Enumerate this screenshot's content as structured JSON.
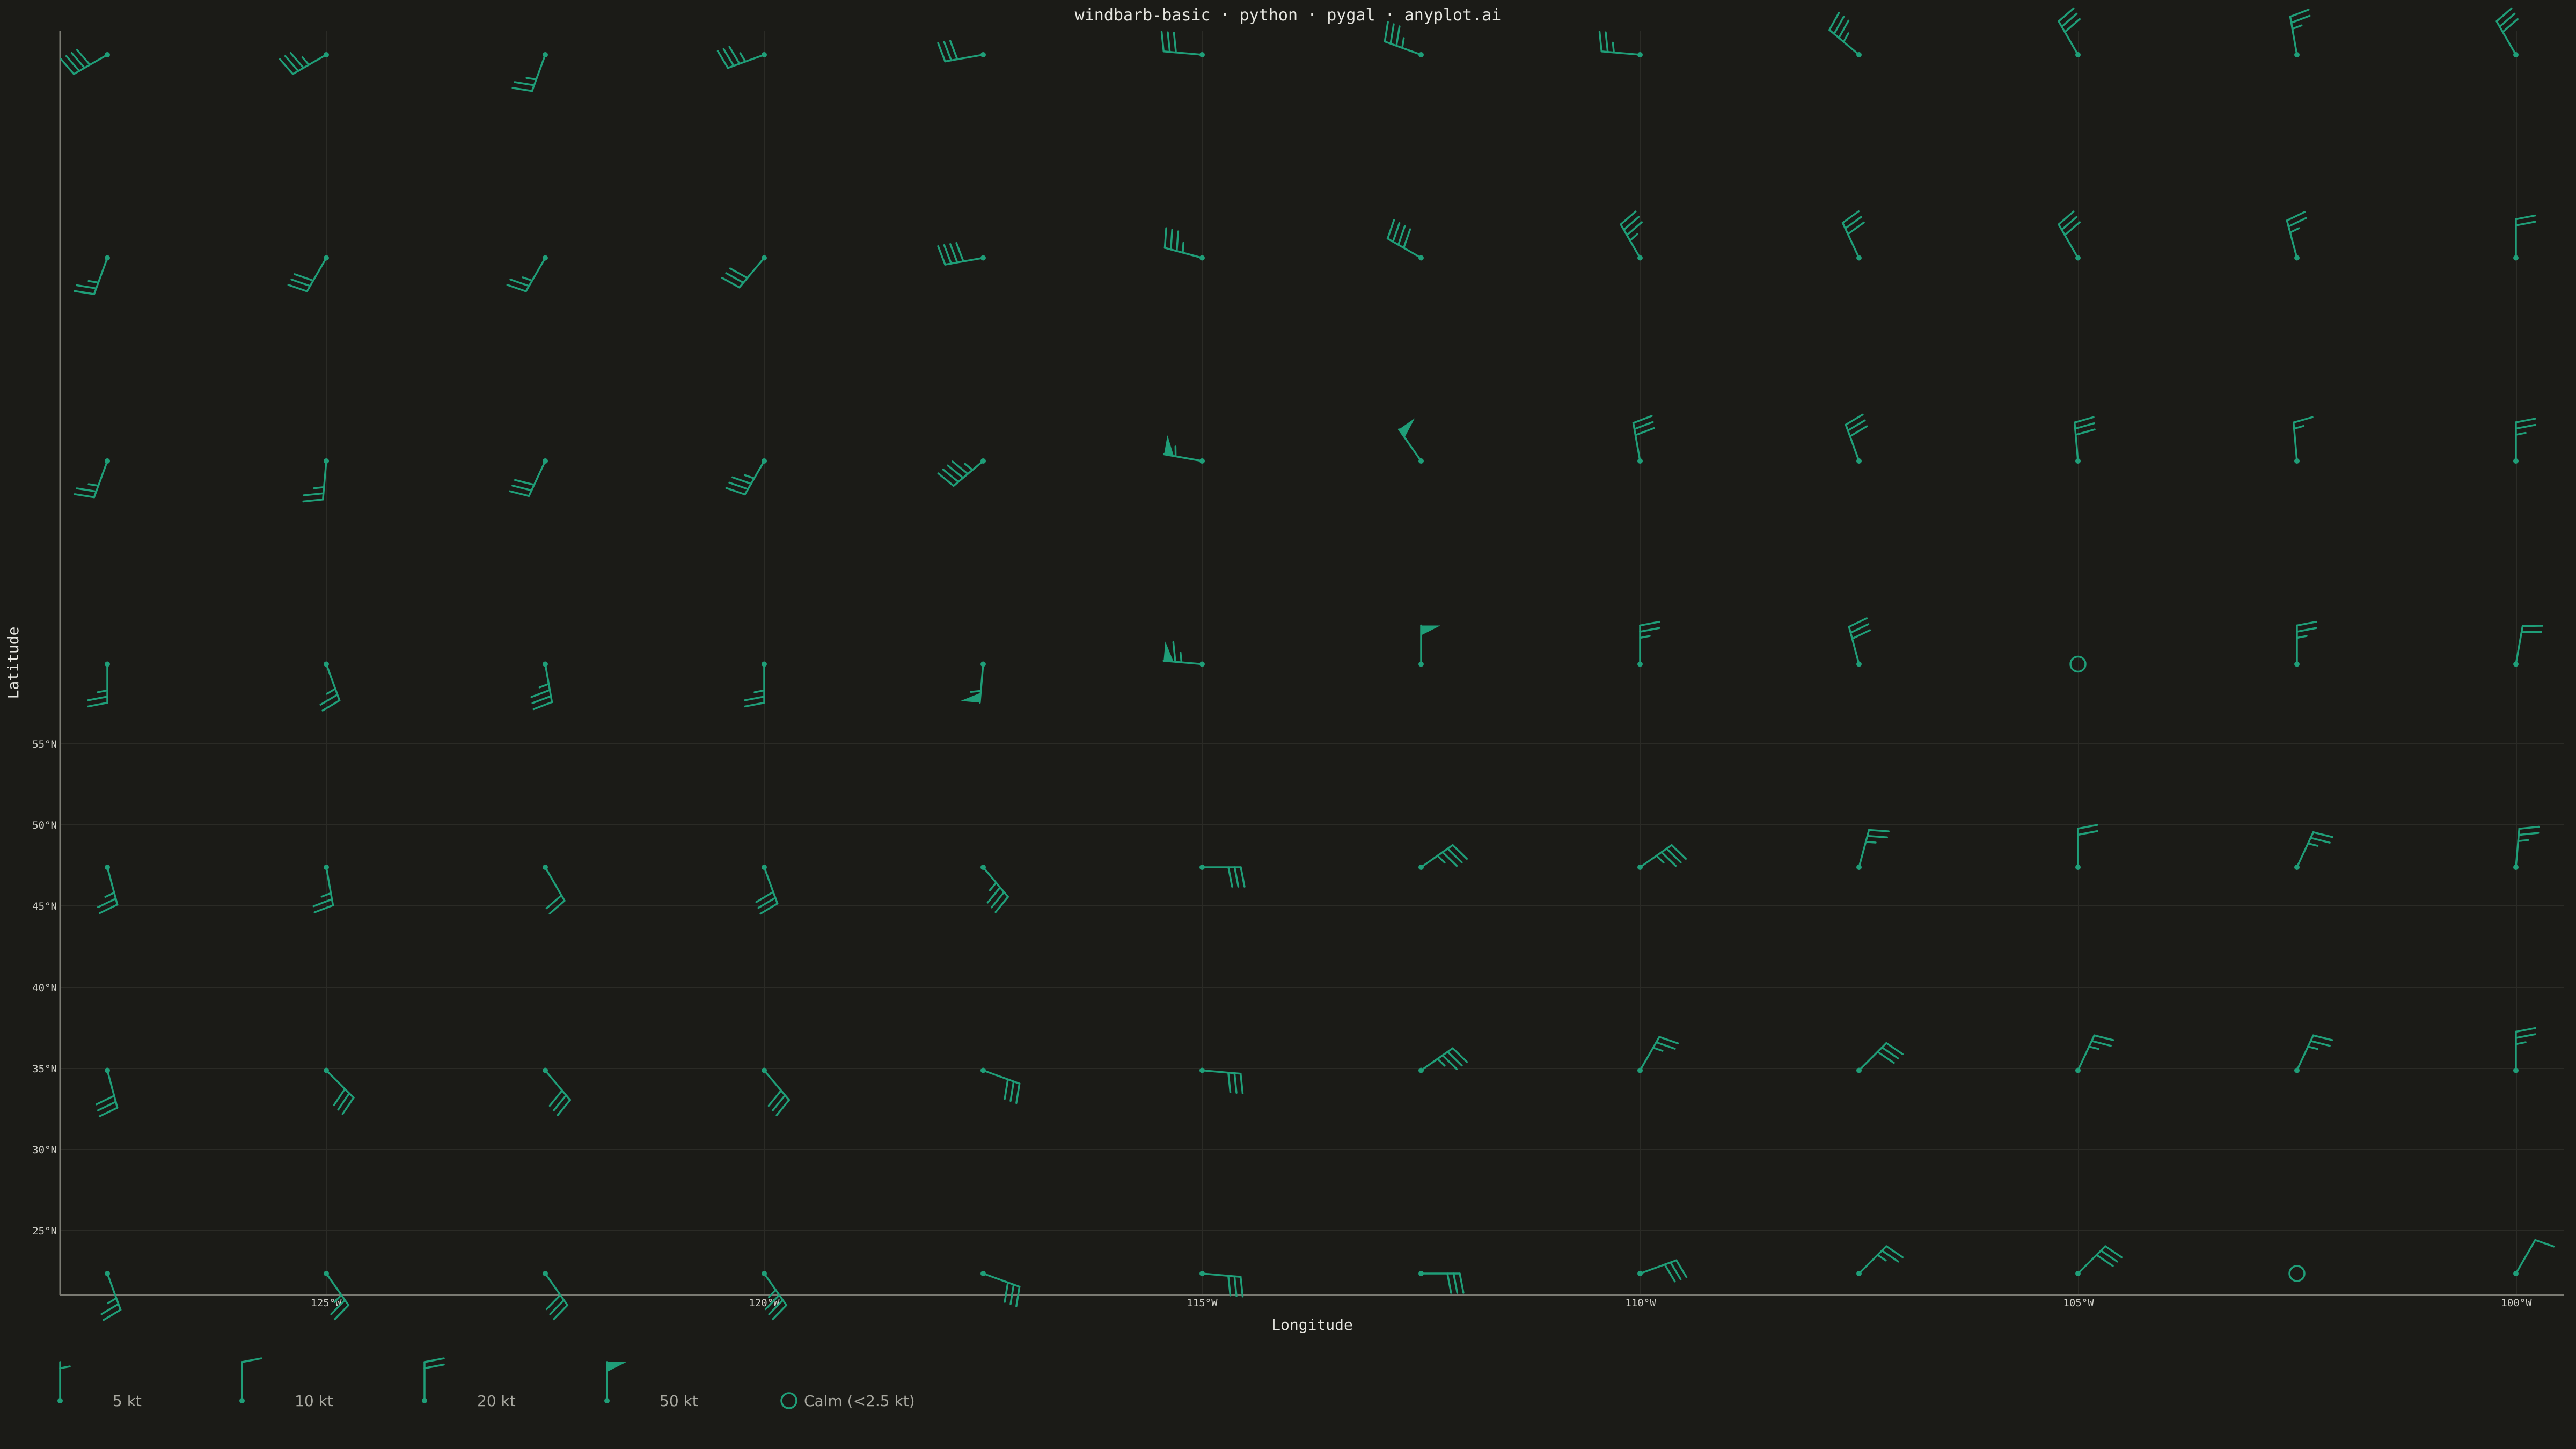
{
  "colors": {
    "background": "#1b1b17",
    "barb": "#1f9e78",
    "text": "#e6e6e0",
    "grid": "#2b2b26"
  },
  "chart_data": {
    "type": "windbarb",
    "title": "windbarb-basic · python · pygal · anyplot.ai",
    "xlabel": "Longitude",
    "ylabel": "Latitude",
    "grid": true,
    "legend_position": "bottom-left",
    "x_ticks": [
      "125°W",
      "120°W",
      "115°W",
      "110°W",
      "105°W",
      "100°W"
    ],
    "y_ticks": [
      "55°N",
      "50°N",
      "45°N",
      "40°N",
      "35°N",
      "30°N",
      "25°N"
    ],
    "barb_units": "kt",
    "legend": [
      {
        "label": "5 kt",
        "speed": 5
      },
      {
        "label": "10 kt",
        "speed": 10
      },
      {
        "label": "20 kt",
        "speed": 20
      },
      {
        "label": "50 kt",
        "speed": 50
      },
      {
        "label": "Calm (<2.5 kt)",
        "speed": 0
      }
    ],
    "barb_columns": 12,
    "barb_rows": 7,
    "barbs": [
      [
        {
          "dir": 240,
          "speed": 40
        },
        {
          "dir": 240,
          "speed": 35
        },
        {
          "dir": 200,
          "speed": 25
        },
        {
          "dir": 250,
          "speed": 35
        },
        {
          "dir": 260,
          "speed": 30
        },
        {
          "dir": 275,
          "speed": 30
        },
        {
          "dir": 290,
          "speed": 35
        },
        {
          "dir": 275,
          "speed": 25
        },
        {
          "dir": 310,
          "speed": 35
        },
        {
          "dir": 330,
          "speed": 30
        },
        {
          "dir": 350,
          "speed": 25
        },
        {
          "dir": 330,
          "speed": 30
        }
      ],
      [
        {
          "dir": 200,
          "speed": 25
        },
        {
          "dir": 210,
          "speed": 30
        },
        {
          "dir": 210,
          "speed": 25
        },
        {
          "dir": 220,
          "speed": 30
        },
        {
          "dir": 260,
          "speed": 40
        },
        {
          "dir": 285,
          "speed": 35
        },
        {
          "dir": 300,
          "speed": 40
        },
        {
          "dir": 330,
          "speed": 35
        },
        {
          "dir": 335,
          "speed": 30
        },
        {
          "dir": 330,
          "speed": 30
        },
        {
          "dir": 345,
          "speed": 25
        },
        {
          "dir": 0,
          "speed": 20
        }
      ],
      [
        {
          "dir": 200,
          "speed": 25
        },
        {
          "dir": 185,
          "speed": 25
        },
        {
          "dir": 205,
          "speed": 30
        },
        {
          "dir": 210,
          "speed": 35
        },
        {
          "dir": 230,
          "speed": 45
        },
        {
          "dir": 280,
          "speed": 55
        },
        {
          "dir": 325,
          "speed": 50
        },
        {
          "dir": 350,
          "speed": 30
        },
        {
          "dir": 340,
          "speed": 30
        },
        {
          "dir": 355,
          "speed": 30
        },
        {
          "dir": 355,
          "speed": 15
        },
        {
          "dir": 0,
          "speed": 25
        }
      ],
      [
        {
          "dir": 180,
          "speed": 25
        },
        {
          "dir": 160,
          "speed": 25
        },
        {
          "dir": 170,
          "speed": 35
        },
        {
          "dir": 180,
          "speed": 25
        },
        {
          "dir": 185,
          "speed": 55
        },
        {
          "dir": 275,
          "speed": 65
        },
        {
          "dir": 0,
          "speed": 50
        },
        {
          "dir": 0,
          "speed": 25
        },
        {
          "dir": 345,
          "speed": 30
        },
        {
          "dir": 0,
          "speed": 0
        },
        {
          "dir": 0,
          "speed": 25
        },
        {
          "dir": 10,
          "speed": 20
        }
      ],
      [
        {
          "dir": 165,
          "speed": 25
        },
        {
          "dir": 170,
          "speed": 25
        },
        {
          "dir": 150,
          "speed": 20
        },
        {
          "dir": 160,
          "speed": 30
        },
        {
          "dir": 140,
          "speed": 35
        },
        {
          "dir": 90,
          "speed": 30
        },
        {
          "dir": 55,
          "speed": 35
        },
        {
          "dir": 55,
          "speed": 35
        },
        {
          "dir": 15,
          "speed": 25
        },
        {
          "dir": 0,
          "speed": 20
        },
        {
          "dir": 25,
          "speed": 25
        },
        {
          "dir": 5,
          "speed": 25
        }
      ],
      [
        {
          "dir": 165,
          "speed": 30
        },
        {
          "dir": 135,
          "speed": 30
        },
        {
          "dir": 140,
          "speed": 30
        },
        {
          "dir": 140,
          "speed": 30
        },
        {
          "dir": 110,
          "speed": 30
        },
        {
          "dir": 95,
          "speed": 30
        },
        {
          "dir": 55,
          "speed": 35
        },
        {
          "dir": 30,
          "speed": 25
        },
        {
          "dir": 45,
          "speed": 30
        },
        {
          "dir": 25,
          "speed": 25
        },
        {
          "dir": 25,
          "speed": 25
        },
        {
          "dir": 0,
          "speed": 25
        }
      ],
      [
        {
          "dir": 160,
          "speed": 25
        },
        {
          "dir": 145,
          "speed": 25
        },
        {
          "dir": 145,
          "speed": 30
        },
        {
          "dir": 145,
          "speed": 35
        },
        {
          "dir": 110,
          "speed": 30
        },
        {
          "dir": 95,
          "speed": 30
        },
        {
          "dir": 90,
          "speed": 30
        },
        {
          "dir": 70,
          "speed": 30
        },
        {
          "dir": 45,
          "speed": 25
        },
        {
          "dir": 45,
          "speed": 30
        },
        {
          "dir": 0,
          "speed": 0
        },
        {
          "dir": 30,
          "speed": 10
        }
      ]
    ]
  }
}
